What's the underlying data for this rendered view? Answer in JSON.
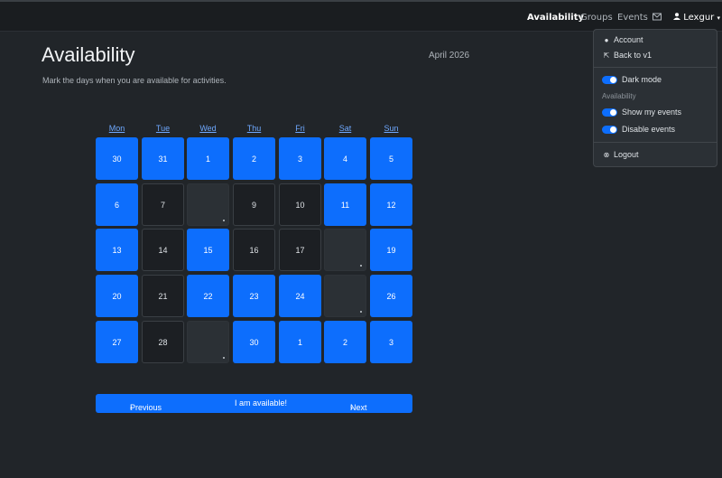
{
  "navbar": {
    "links": [
      {
        "label": "Availability",
        "active": true
      },
      {
        "label": "Groups",
        "active": false
      },
      {
        "label": "Events",
        "active": false
      }
    ],
    "mail_icon": "envelope-icon",
    "user_icon": "person-icon",
    "user_name": "Lexgur",
    "caret_icon": "caret-down-icon"
  },
  "page": {
    "title": "Availability",
    "subtitle": "Mark the days when you are available for activities.",
    "month": "April 2026"
  },
  "calendar": {
    "weekdays": [
      "Mon",
      "Tue",
      "Wed",
      "Thu",
      "Fri",
      "Sat",
      "Sun"
    ],
    "weeks": [
      [
        {
          "label": "30",
          "state": "on"
        },
        {
          "label": "31",
          "state": "on"
        },
        {
          "label": "1",
          "state": "on"
        },
        {
          "label": "2",
          "state": "on"
        },
        {
          "label": "3",
          "state": "on"
        },
        {
          "label": "4",
          "state": "on"
        },
        {
          "label": "5",
          "state": "on"
        }
      ],
      [
        {
          "label": "6",
          "state": "on"
        },
        {
          "label": "7",
          "state": "off"
        },
        {
          "label": "",
          "state": "disabled"
        },
        {
          "label": "9",
          "state": "off"
        },
        {
          "label": "10",
          "state": "off"
        },
        {
          "label": "11",
          "state": "on"
        },
        {
          "label": "12",
          "state": "on"
        }
      ],
      [
        {
          "label": "13",
          "state": "on"
        },
        {
          "label": "14",
          "state": "off"
        },
        {
          "label": "15",
          "state": "on"
        },
        {
          "label": "16",
          "state": "off"
        },
        {
          "label": "17",
          "state": "off"
        },
        {
          "label": "",
          "state": "disabled"
        },
        {
          "label": "19",
          "state": "on"
        }
      ],
      [
        {
          "label": "20",
          "state": "on"
        },
        {
          "label": "21",
          "state": "off"
        },
        {
          "label": "22",
          "state": "on"
        },
        {
          "label": "23",
          "state": "on"
        },
        {
          "label": "24",
          "state": "on"
        },
        {
          "label": "",
          "state": "disabled"
        },
        {
          "label": "26",
          "state": "on"
        }
      ],
      [
        {
          "label": "27",
          "state": "on"
        },
        {
          "label": "28",
          "state": "off"
        },
        {
          "label": "",
          "state": "disabled"
        },
        {
          "label": "30",
          "state": "on"
        },
        {
          "label": "1",
          "state": "on"
        },
        {
          "label": "2",
          "state": "on"
        },
        {
          "label": "3",
          "state": "on"
        }
      ]
    ]
  },
  "actions": {
    "previous": "Previous",
    "available": "I am available!",
    "next": "Next"
  },
  "dropdown": {
    "account": "Account",
    "back": "Back to v1",
    "dark_mode": "Dark mode",
    "availability_header": "Availability",
    "show_events": "Show my events",
    "disable_events": "Disable events",
    "logout": "Logout"
  },
  "colors": {
    "accent": "#0d6efd",
    "background": "#212529",
    "navbar": "#1a1d20"
  }
}
